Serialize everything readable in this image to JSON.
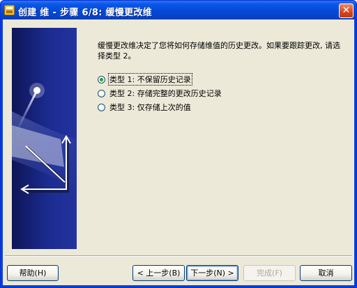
{
  "window": {
    "title": "创建 维 - 步骤 6/8: 缓慢更改维",
    "close_glyph": "✕"
  },
  "prompt": "缓慢更改维决定了您将如何存储维值的历史更改。如果要跟踪更改, 请选择类型 2。",
  "options": [
    {
      "label": "类型 1: 不保留历史记录",
      "checked": true
    },
    {
      "label": "类型 2: 存储完整的更改历史记录",
      "checked": false
    },
    {
      "label": "类型 3: 仅存储上次的值",
      "checked": false
    }
  ],
  "buttons": {
    "help": "帮助(H)",
    "back": "< 上一步(B)",
    "next": "下一步(N) >",
    "finish": "完成(F)",
    "cancel": "取消"
  }
}
